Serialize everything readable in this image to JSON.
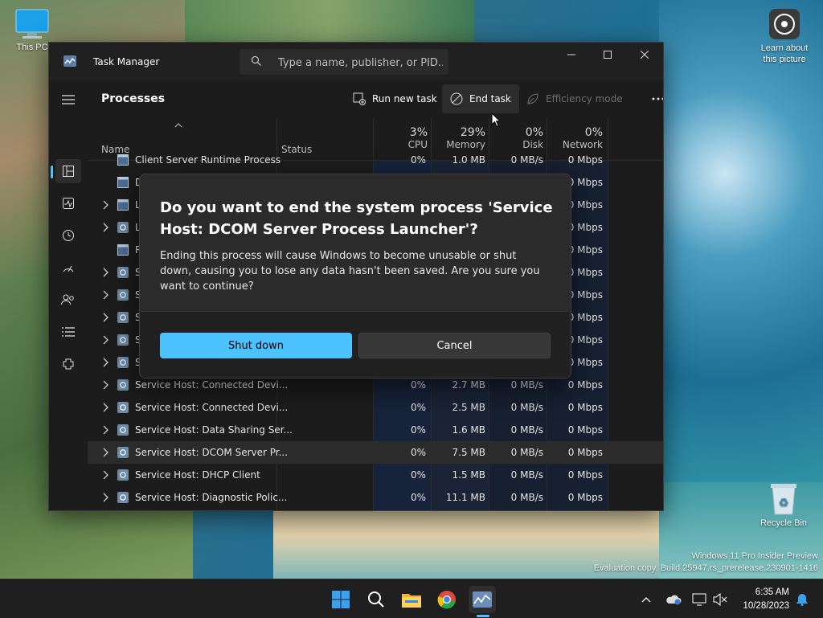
{
  "desktop": {
    "icons": [
      {
        "label": "This PC"
      },
      {
        "label": "Learn about this picture"
      },
      {
        "label": "Recycle Bin"
      }
    ],
    "watermark": {
      "line1": "Windows 11 Pro Insider Preview",
      "line2": "Evaluation copy. Build 25947.rs_prerelease.230901-1416"
    }
  },
  "window": {
    "title": "Task Manager",
    "search_placeholder": "Type a name, publisher, or PID...",
    "controls": {
      "minimize": "minimize-icon",
      "maximize": "maximize-icon",
      "close": "close-icon"
    }
  },
  "sidebar": {
    "items": [
      {
        "name": "menu",
        "icon": "hamburger-icon"
      },
      {
        "name": "processes",
        "icon": "processes-icon",
        "active": true
      },
      {
        "name": "performance",
        "icon": "performance-icon"
      },
      {
        "name": "app-history",
        "icon": "history-icon"
      },
      {
        "name": "startup-apps",
        "icon": "startup-icon"
      },
      {
        "name": "users",
        "icon": "users-icon"
      },
      {
        "name": "details",
        "icon": "details-icon"
      },
      {
        "name": "services",
        "icon": "services-icon"
      },
      {
        "name": "settings",
        "icon": "gear-icon"
      }
    ]
  },
  "toolbar": {
    "page_title": "Processes",
    "run_new_task": "Run new task",
    "end_task": "End task",
    "efficiency_mode": "Efficiency mode"
  },
  "table": {
    "columns": {
      "name": "Name",
      "status": "Status",
      "cpu": {
        "pct": "3%",
        "label": "CPU"
      },
      "memory": {
        "pct": "29%",
        "label": "Memory"
      },
      "disk": {
        "pct": "0%",
        "label": "Disk"
      },
      "network": {
        "pct": "0%",
        "label": "Network"
      }
    },
    "rows": [
      {
        "name": "Client Server Runtime Process",
        "cpu": "0%",
        "memory": "1.0 MB",
        "disk": "0 MB/s",
        "network": "0 Mbps",
        "expandable": false,
        "icon": "window"
      },
      {
        "name": "D",
        "cpu": "",
        "memory": "",
        "disk": "",
        "network": "0 Mbps",
        "expandable": false,
        "icon": "window"
      },
      {
        "name": "L",
        "cpu": "",
        "memory": "",
        "disk": "",
        "network": "0 Mbps",
        "expandable": true,
        "icon": "window"
      },
      {
        "name": "L",
        "cpu": "",
        "memory": "",
        "disk": "",
        "network": "0 Mbps",
        "expandable": true,
        "icon": "gear"
      },
      {
        "name": "R",
        "cpu": "",
        "memory": "",
        "disk": "",
        "network": "0 Mbps",
        "expandable": false,
        "icon": "window"
      },
      {
        "name": "S",
        "cpu": "",
        "memory": "",
        "disk": "",
        "network": "0 Mbps",
        "expandable": true,
        "icon": "gear"
      },
      {
        "name": "S",
        "cpu": "",
        "memory": "",
        "disk": "",
        "network": "0 Mbps",
        "expandable": true,
        "icon": "gear"
      },
      {
        "name": "S",
        "cpu": "",
        "memory": "",
        "disk": "",
        "network": "0 Mbps",
        "expandable": true,
        "icon": "gear"
      },
      {
        "name": "S",
        "cpu": "",
        "memory": "",
        "disk": "",
        "network": "0 Mbps",
        "expandable": true,
        "icon": "gear"
      },
      {
        "name": "S",
        "cpu": "",
        "memory": "",
        "disk": "",
        "network": "0 Mbps",
        "expandable": true,
        "icon": "gear"
      },
      {
        "name": "Service Host: Connected Devi...",
        "cpu": "0%",
        "memory": "2.7 MB",
        "disk": "0 MB/s",
        "network": "0 Mbps",
        "expandable": true,
        "icon": "gear"
      },
      {
        "name": "Service Host: Connected Devi...",
        "cpu": "0%",
        "memory": "2.5 MB",
        "disk": "0 MB/s",
        "network": "0 Mbps",
        "expandable": true,
        "icon": "gear"
      },
      {
        "name": "Service Host: Data Sharing Ser...",
        "cpu": "0%",
        "memory": "1.6 MB",
        "disk": "0 MB/s",
        "network": "0 Mbps",
        "expandable": true,
        "icon": "gear"
      },
      {
        "name": "Service Host: DCOM Server Pr...",
        "cpu": "0%",
        "memory": "7.5 MB",
        "disk": "0 MB/s",
        "network": "0 Mbps",
        "expandable": true,
        "icon": "gear",
        "selected": true
      },
      {
        "name": "Service Host: DHCP Client",
        "cpu": "0%",
        "memory": "1.5 MB",
        "disk": "0 MB/s",
        "network": "0 Mbps",
        "expandable": true,
        "icon": "gear"
      },
      {
        "name": "Service Host: Diagnostic Polic...",
        "cpu": "0%",
        "memory": "11.1 MB",
        "disk": "0 MB/s",
        "network": "0 Mbps",
        "expandable": true,
        "icon": "gear"
      }
    ]
  },
  "dialog": {
    "title": "Do you want to end the system process 'Service Host: DCOM Server Process Launcher'?",
    "body": "Ending this process will cause Windows to become unusable or shut down, causing you to lose any data hasn't been saved. Are you sure you want to continue?",
    "primary": "Shut down",
    "secondary": "Cancel"
  },
  "taskbar": {
    "apps": [
      "start-icon",
      "search-icon",
      "file-explorer-icon",
      "chrome-icon",
      "task-manager-icon"
    ],
    "tray": [
      "chevron-up-icon",
      "onedrive-icon",
      "display-icon",
      "volume-muted-icon"
    ],
    "time": "6:35 AM",
    "date": "10/28/2023",
    "notification": "bell-icon"
  },
  "colors": {
    "accent": "#4cc2ff",
    "window_bg": "#1c1c1c",
    "dialog_bg": "#2b2b2b"
  }
}
